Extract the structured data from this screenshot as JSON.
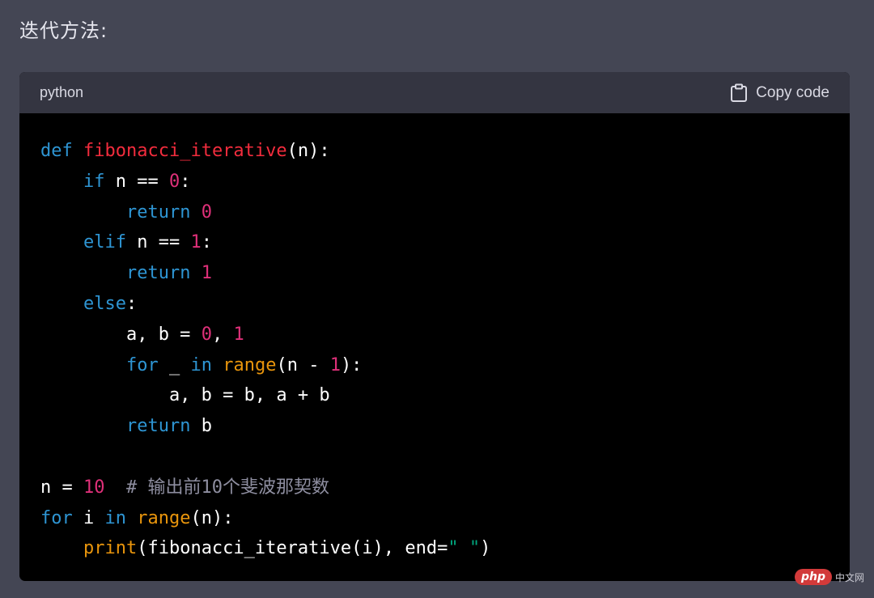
{
  "heading": "迭代方法:",
  "code_block": {
    "language": "python",
    "copy_label": "Copy code",
    "lines": [
      [
        {
          "t": "def",
          "c": "kw"
        },
        {
          "t": " "
        },
        {
          "t": "fibonacci_iterative",
          "c": "fn"
        },
        {
          "t": "(n):"
        }
      ],
      [
        {
          "t": "    "
        },
        {
          "t": "if",
          "c": "kw"
        },
        {
          "t": " n == "
        },
        {
          "t": "0",
          "c": "num"
        },
        {
          "t": ":"
        }
      ],
      [
        {
          "t": "        "
        },
        {
          "t": "return",
          "c": "kw"
        },
        {
          "t": " "
        },
        {
          "t": "0",
          "c": "num"
        }
      ],
      [
        {
          "t": "    "
        },
        {
          "t": "elif",
          "c": "kw"
        },
        {
          "t": " n == "
        },
        {
          "t": "1",
          "c": "num"
        },
        {
          "t": ":"
        }
      ],
      [
        {
          "t": "        "
        },
        {
          "t": "return",
          "c": "kw"
        },
        {
          "t": " "
        },
        {
          "t": "1",
          "c": "num"
        }
      ],
      [
        {
          "t": "    "
        },
        {
          "t": "else",
          "c": "kw"
        },
        {
          "t": ":"
        }
      ],
      [
        {
          "t": "        a, b = "
        },
        {
          "t": "0",
          "c": "num"
        },
        {
          "t": ", "
        },
        {
          "t": "1",
          "c": "num"
        }
      ],
      [
        {
          "t": "        "
        },
        {
          "t": "for",
          "c": "kw"
        },
        {
          "t": " _ "
        },
        {
          "t": "in",
          "c": "kw"
        },
        {
          "t": " "
        },
        {
          "t": "range",
          "c": "bi"
        },
        {
          "t": "(n - "
        },
        {
          "t": "1",
          "c": "num"
        },
        {
          "t": "):"
        }
      ],
      [
        {
          "t": "            a, b = b, a + b"
        }
      ],
      [
        {
          "t": "        "
        },
        {
          "t": "return",
          "c": "kw"
        },
        {
          "t": " b"
        }
      ],
      [],
      [
        {
          "t": "n = "
        },
        {
          "t": "10",
          "c": "num"
        },
        {
          "t": "  "
        },
        {
          "t": "# 输出前10个斐波那契数",
          "c": "cm"
        }
      ],
      [
        {
          "t": "for",
          "c": "kw"
        },
        {
          "t": " i "
        },
        {
          "t": "in",
          "c": "kw"
        },
        {
          "t": " "
        },
        {
          "t": "range",
          "c": "bi"
        },
        {
          "t": "(n):"
        }
      ],
      [
        {
          "t": "    "
        },
        {
          "t": "print",
          "c": "bi"
        },
        {
          "t": "(fibonacci_iterative(i), end="
        },
        {
          "t": "\" \"",
          "c": "str"
        },
        {
          "t": ")"
        }
      ]
    ]
  },
  "watermark": {
    "logo": "php",
    "text": "中文网"
  },
  "colors": {
    "keyword": "#2e95d3",
    "function_name": "#f22c3d",
    "number": "#df3079",
    "builtin": "#e9950c",
    "string": "#00a67d",
    "comment": "#8e8ea0"
  },
  "icons": {
    "copy": "clipboard-icon"
  }
}
